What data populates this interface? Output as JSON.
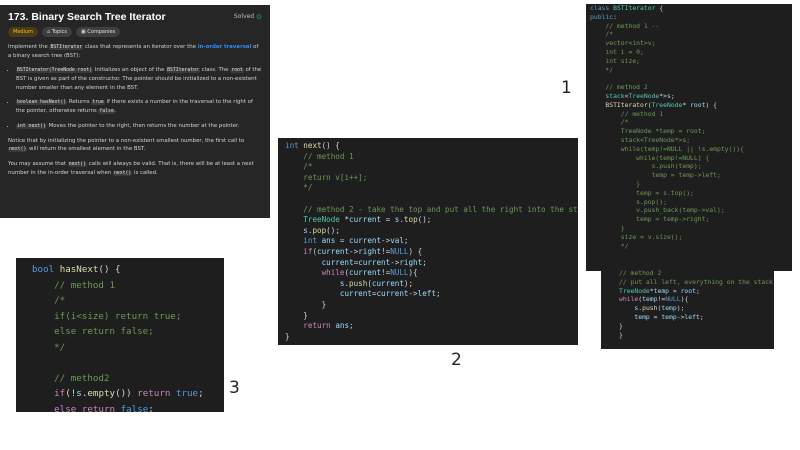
{
  "problem": {
    "title": "173. Binary Search Tree Iterator",
    "status": "Solved",
    "tags": [
      "Medium",
      "Topics",
      "Companies"
    ],
    "desc_before_class": "Implement the",
    "class_name": "BSTIterator",
    "desc_mid": "class that represents an iterator over the",
    "desc_link": "in-order traversal",
    "desc_end": "of a binary search tree (BST):",
    "b1_code": "BSTIterator(TreeNode root)",
    "b1_text_a": "Initializes an object of the",
    "b1_code2": "BSTIterator",
    "b1_text_b": "class. The",
    "b1_code3": "root",
    "b1_text_c": "of the BST is given as part of the constructor. The pointer should be initialized to a non-existent number smaller than any element in the BST.",
    "b2_code": "boolean hasNext()",
    "b2_text_a": "Returns",
    "b2_code2": "true",
    "b2_text_b": "if there exists a number in the traversal to the right of the pointer, otherwise returns",
    "b2_code3": "false",
    "b3_code": "int next()",
    "b3_text": "Moves the pointer to the right, then returns the number at the pointer.",
    "note_a": "Notice that by initializing the pointer to a non-existent smallest number, the first call to",
    "note_code": "next()",
    "note_b": "will return the smallest element in the BST.",
    "assume_a": "You may assume that",
    "assume_code": "next()",
    "assume_b": "calls will always be valid. That is, there will be at least a next number in the in-order traversal when",
    "assume_code2": "next()",
    "assume_c": "is called."
  },
  "labels": {
    "one": "1",
    "two": "2",
    "three": "3"
  },
  "colors": {
    "panel_bg": "#1e1e1e",
    "problem_bg": "#262626",
    "keyword": "#569cd6",
    "comment": "#6a9955",
    "function": "#dcdcaa",
    "link": "#2f8cff",
    "solved": "#2cbb5d",
    "medium": "#ffc01e"
  }
}
